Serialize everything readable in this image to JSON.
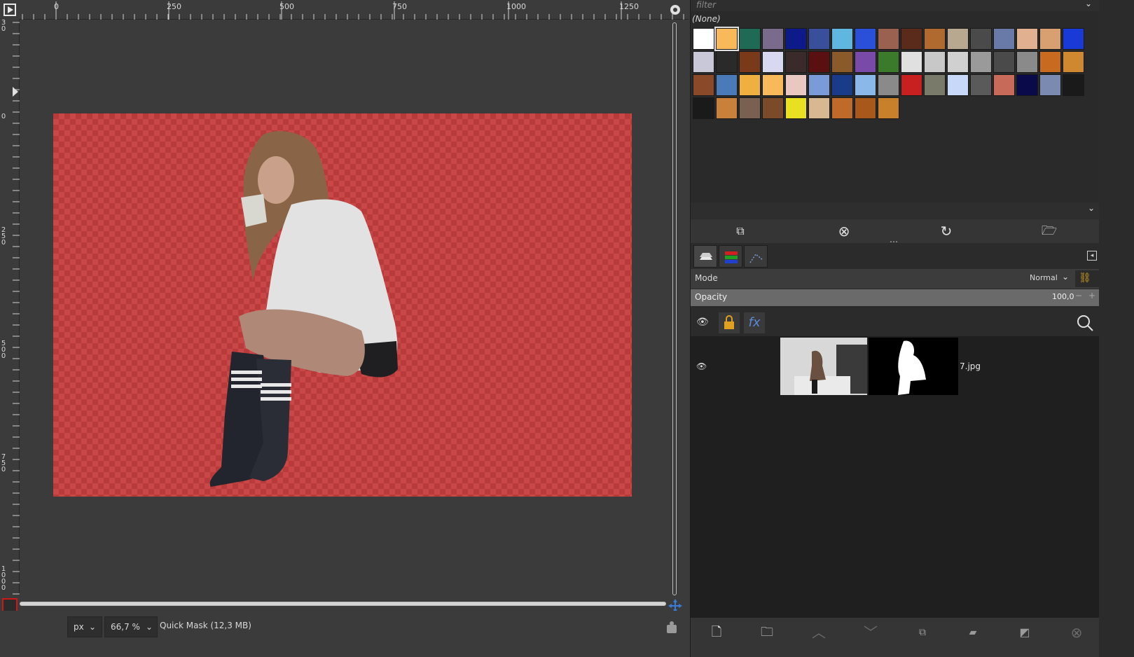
{
  "ruler": {
    "h_labels": [
      "0",
      "250",
      "500",
      "750",
      "1000",
      "1250"
    ],
    "v_labels": [
      [
        "3",
        "0"
      ],
      [
        "0"
      ],
      [
        "2",
        "5",
        "0"
      ],
      [
        "5",
        "0",
        "0"
      ],
      [
        "7",
        "5",
        "0"
      ],
      [
        "1",
        "0",
        "0",
        "0"
      ]
    ]
  },
  "canvas": {
    "mask_color": "#b83a3a"
  },
  "statusbar": {
    "unit": "px",
    "zoom": "66,7 %",
    "message": "Quick Mask (12,3 MB)"
  },
  "patterns": {
    "filter_placeholder": "filter",
    "selected_name": "(None)",
    "swatches": [
      "#ffffff",
      "#f7b95a",
      "#1f6a55",
      "#7a6a8c",
      "#0c1a8a",
      "#3a4f9c",
      "#5fb7e0",
      "#2a4fd8",
      "#9a6050",
      "#5a2a1a",
      "#b06a30",
      "#b8a890",
      "#4a4a4a",
      "#6a7aa8",
      "#e0b090",
      "#d8a070",
      "#1a3ad8",
      "#c8c8d8",
      "#2a2a2a",
      "#7a3a1a",
      "#d8d8f0",
      "#3a2a2a",
      "#5a1010",
      "#8a5a2a",
      "#7a4aa8",
      "#3a7a2a",
      "#e0e0e0",
      "#c8c8c8",
      "#d0d0d0",
      "#9a9a9a",
      "#4a4a4a",
      "#8a8a8a",
      "#c86a20",
      "#d08830",
      "#8a4a2a",
      "#4a7ab8",
      "#f0b040",
      "#f7b95a",
      "#e8c8c0",
      "#7a9ad8",
      "#1a3a8a",
      "#8ab8e8",
      "#8a8a8a",
      "#c82020",
      "#7a7a6a",
      "#c8d8f8",
      "#5a5a5a",
      "#c86a5a",
      "#0a0a4a",
      "#7a8ab0",
      "#1a1a1a",
      "#1a1a1a",
      "#c8803a",
      "#7a6050",
      "#7a4a2a",
      "#e8e020",
      "#d8b890",
      "#c06a2a",
      "#a8581a",
      "#c8802a"
    ]
  },
  "pattern_actions": [
    "duplicate-icon",
    "delete-icon",
    "refresh-icon",
    "open-folder-icon"
  ],
  "layers_panel": {
    "mode_label": "Mode",
    "mode_value": "Normal",
    "opacity_label": "Opacity",
    "opacity_value": "100,0",
    "opacity_minus": "−",
    "opacity_plus": "+",
    "layer_name": "7.jpg"
  }
}
